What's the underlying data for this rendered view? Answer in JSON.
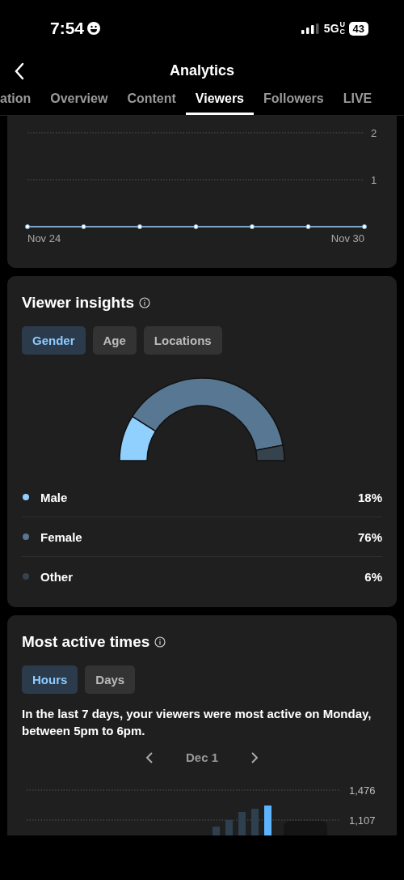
{
  "status_bar": {
    "time": "7:54",
    "network": "5G",
    "network_suffix": "UC",
    "battery": "43"
  },
  "header": {
    "title": "Analytics"
  },
  "tabs": [
    {
      "label": "ation",
      "selected": false
    },
    {
      "label": "Overview",
      "selected": false
    },
    {
      "label": "Content",
      "selected": false
    },
    {
      "label": "Viewers",
      "selected": true
    },
    {
      "label": "Followers",
      "selected": false
    },
    {
      "label": "LIVE",
      "selected": false
    }
  ],
  "viewers_chart": {
    "y_labels": [
      "2",
      "1"
    ],
    "x_labels": [
      "Nov 24",
      "Nov 30"
    ]
  },
  "viewer_insights": {
    "title": "Viewer insights",
    "filters": [
      {
        "label": "Gender",
        "selected": true
      },
      {
        "label": "Age",
        "selected": false
      },
      {
        "label": "Locations",
        "selected": false
      }
    ],
    "legend": [
      {
        "label": "Male",
        "value": "18%",
        "color": "#8fd0ff"
      },
      {
        "label": "Female",
        "value": "76%",
        "color": "#587792"
      },
      {
        "label": "Other",
        "value": "6%",
        "color": "#35434f"
      }
    ]
  },
  "most_active_times": {
    "title": "Most active times",
    "filters": [
      {
        "label": "Hours",
        "selected": true
      },
      {
        "label": "Days",
        "selected": false
      }
    ],
    "summary": "In the last 7 days, your viewers were most active on Monday, between 5pm to 6pm.",
    "date": "Dec 1",
    "y_labels": [
      "1,476",
      "1,107"
    ]
  }
}
